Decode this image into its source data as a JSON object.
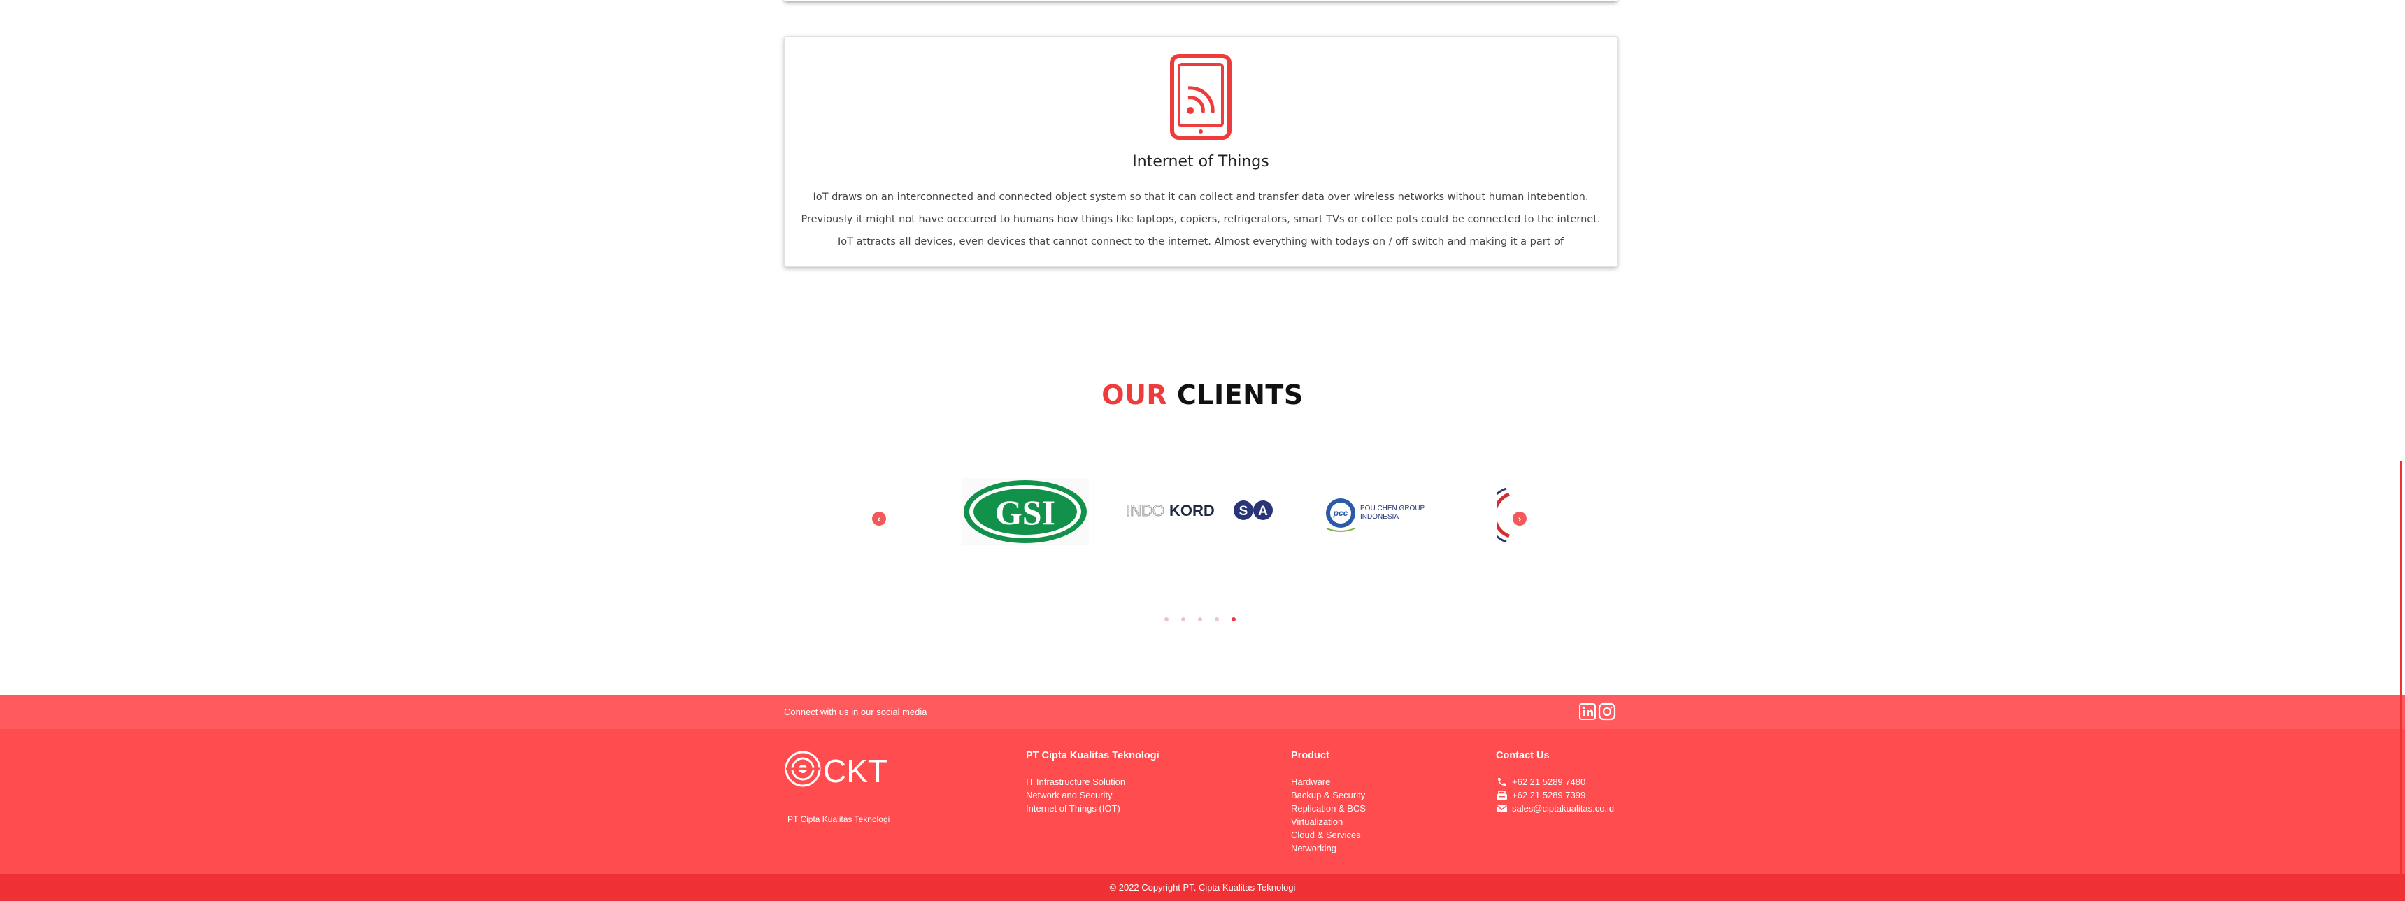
{
  "service": {
    "title": "Internet of Things",
    "description": "IoT draws on an interconnected and connected object system so that it can collect and transfer data over wireless networks without human intebention. Previously it might not have occcurred to humans how things like laptops, copiers, refrigerators, smart TVs or coffee pots could be connected to the internet. IoT attracts all devices, even devices that cannot connect to the internet. Almost everything with todays on / off switch and making it a part of",
    "icon": "iot-tablet-icon"
  },
  "clients": {
    "title_accent": "OUR",
    "title_rest": "CLIENTS",
    "logos": [
      {
        "name": "GSI",
        "text": "GSI"
      },
      {
        "name": "Indo Kordsa",
        "text_a": "INDO",
        "text_b": "KORD",
        "text_c": "SA"
      },
      {
        "name": "Pou Chen Group Indonesia",
        "text_line1": "POU CHEN GROUP",
        "text_line2": "INDONESIA",
        "mark": "pcc"
      }
    ],
    "prev_icon": "chevron-left-icon",
    "next_icon": "chevron-right-icon",
    "dots": 5,
    "active_dot": 4
  },
  "social": {
    "text": "Connect with us in our social media",
    "icons": [
      "linkedin-icon",
      "instagram-icon"
    ]
  },
  "footer": {
    "brand": {
      "logo_text": "CKT",
      "name": "PT Cipta Kualitas Teknologi"
    },
    "company": {
      "title": "PT Cipta Kualitas Teknologi",
      "items": [
        "IT Infrastructure Solution",
        "Network and Security",
        "Internet of Things (IOT)"
      ]
    },
    "product": {
      "title": "Product",
      "items": [
        "Hardware",
        "Backup & Security",
        "Replication & BCS",
        "Virtualization",
        "Cloud & Services",
        "Networking"
      ]
    },
    "contact": {
      "title": "Contact Us",
      "phone": "+62 21 5289 7480",
      "fax": "+62 21 5289 7399",
      "email": "sales@ciptakualitas.co.id"
    },
    "copyright": "© 2022 Copyright PT. Cipta Kualitas Teknologi"
  },
  "colors": {
    "accent": "#ee3b3b",
    "footer": "#ff4c4e",
    "social_bar": "#ff5b5e",
    "copyright_bar": "#ef3135"
  }
}
